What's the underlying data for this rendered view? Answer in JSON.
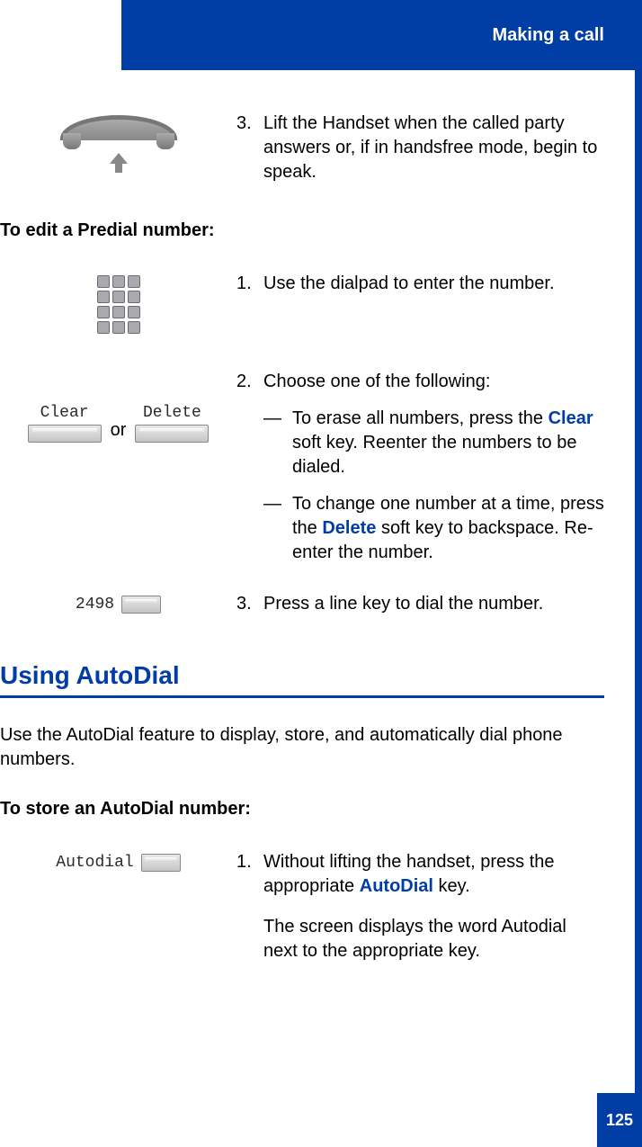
{
  "header": {
    "title": "Making a call"
  },
  "step3_handset": {
    "num": "3.",
    "text": "Lift the Handset when the called party answers or, if in handsfree mode, begin to speak."
  },
  "predial_heading": "To edit a Predial number:",
  "predial": {
    "step1": {
      "num": "1.",
      "text": "Use the dialpad to enter the number."
    },
    "step2": {
      "num": "2.",
      "intro": "Choose one of the following:",
      "dash": "—",
      "opt_a_pre": "To erase all numbers, press the ",
      "opt_a_key": "Clear",
      "opt_a_post": " soft key. Reenter the numbers to be dialed.",
      "opt_b_pre": "To change one number at a time, press the ",
      "opt_b_key": "Delete",
      "opt_b_post": " soft key to backspace. Re-enter the number."
    },
    "step3": {
      "num": "3.",
      "text": "Press a line key to dial the number."
    }
  },
  "softkeys": {
    "clear": "Clear",
    "delete": "Delete",
    "or": "or"
  },
  "linekey": {
    "number": "2498"
  },
  "autodial_section": {
    "heading": "Using AutoDial",
    "intro": "Use the AutoDial feature to display, store, and automatically dial phone numbers.",
    "store_heading": "To store an AutoDial number:",
    "key_label": "Autodial",
    "step1": {
      "num": "1.",
      "pre": "Without lifting the handset, press the appropriate ",
      "key": "AutoDial",
      "post": " key.",
      "line2": "The screen displays the word Autodial next to the appropriate key."
    }
  },
  "page_number": "125"
}
